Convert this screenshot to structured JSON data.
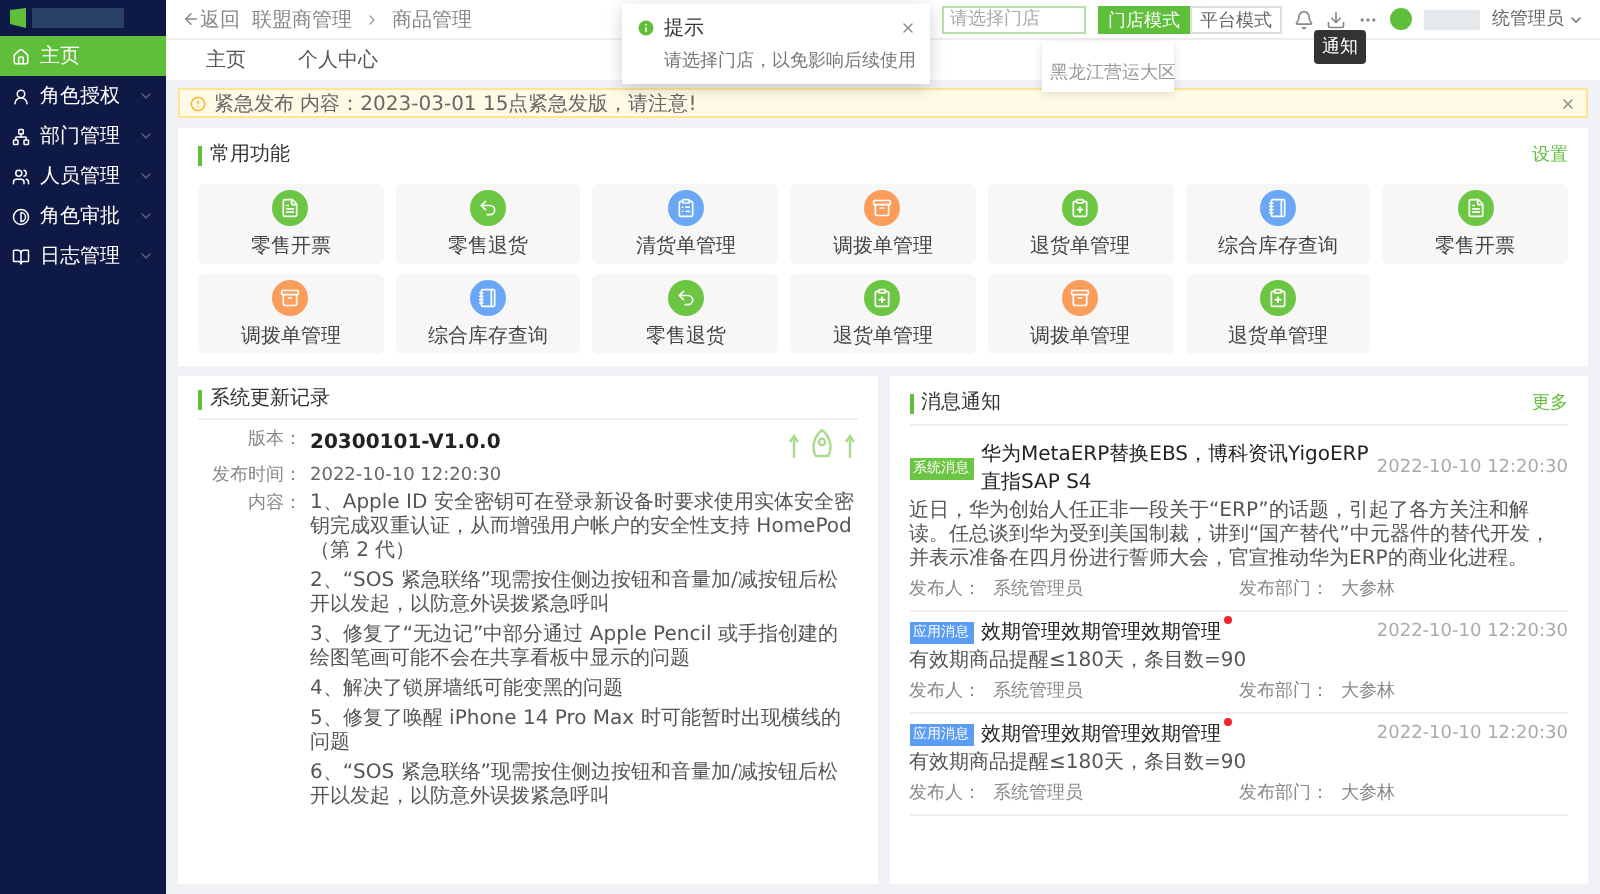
{
  "sidebar": {
    "items": [
      {
        "label": "主页",
        "kind": "home",
        "selected": true,
        "expandable": false
      },
      {
        "label": "角色授权",
        "kind": "user",
        "selected": false,
        "expandable": true
      },
      {
        "label": "部门管理",
        "kind": "org",
        "selected": false,
        "expandable": true
      },
      {
        "label": "人员管理",
        "kind": "people",
        "selected": false,
        "expandable": true
      },
      {
        "label": "角色审批",
        "kind": "approve",
        "selected": false,
        "expandable": true
      },
      {
        "label": "日志管理",
        "kind": "log",
        "selected": false,
        "expandable": true
      }
    ]
  },
  "header": {
    "back": "返回",
    "breadcrumbs": [
      "联盟商管理",
      "商品管理"
    ],
    "store_select": {
      "placeholder": "请选择门店",
      "options": [
        "黑龙江营运大区"
      ]
    },
    "modes": [
      {
        "label": "门店模式",
        "selected": true
      },
      {
        "label": "平台模式",
        "selected": false
      }
    ],
    "tooltip": "通知",
    "user": "统管理员"
  },
  "toast": {
    "title": "提示",
    "message": "请选择门店，以免影响后续使用"
  },
  "tabs": [
    {
      "label": "主页"
    },
    {
      "label": "个人中心"
    }
  ],
  "alert": {
    "text": "紧急发布 内容：2023-03-01 15点紧急发版，请注意!"
  },
  "shortcuts": {
    "title": "常用功能",
    "action": "设置",
    "items": [
      {
        "label": "零售开票",
        "kind": "document",
        "color": "#6cc644"
      },
      {
        "label": "零售退货",
        "kind": "return",
        "color": "#6cc644"
      },
      {
        "label": "清货单管理",
        "kind": "clipboard",
        "color": "#6aa8f7"
      },
      {
        "label": "调拨单管理",
        "kind": "archive",
        "color": "#fb9d5a"
      },
      {
        "label": "退货单管理",
        "kind": "entry",
        "color": "#6cc644"
      },
      {
        "label": "综合库存查询",
        "kind": "notebook",
        "color": "#6aa8f7"
      },
      {
        "label": "零售开票",
        "kind": "document",
        "color": "#6cc644"
      },
      {
        "label": "调拨单管理",
        "kind": "archive",
        "color": "#fb9d5a"
      },
      {
        "label": "综合库存查询",
        "kind": "notebook",
        "color": "#6aa8f7"
      },
      {
        "label": "零售退货",
        "kind": "return",
        "color": "#6cc644"
      },
      {
        "label": "退货单管理",
        "kind": "entry",
        "color": "#6cc644"
      },
      {
        "label": "调拨单管理",
        "kind": "archive",
        "color": "#fb9d5a"
      },
      {
        "label": "退货单管理",
        "kind": "entry",
        "color": "#6cc644"
      }
    ]
  },
  "updates": {
    "title": "系统更新记录",
    "version_label": "版本：",
    "version": "20300101-V1.0.0",
    "time_label": "发布时间：",
    "time": "2022-10-10 12:20:30",
    "content_label": "内容：",
    "items": [
      "1、Apple ID 安全密钥可在登录新设备时要求使用实体安全密钥完成双重认证，从而增强用户帐户的安全性支持 HomePod（第 2 代）",
      "2、“SOS 紧急联络”现需按住侧边按钮和音量加/减按钮后松开以发起，以防意外误拨紧急呼叫",
      "3、修复了“无边记”中部分通过 Apple Pencil 或手指创建的绘图笔画可能不会在共享看板中显示的问题",
      "4、解决了锁屏墙纸可能变黑的问题",
      "5、修复了唤醒 iPhone 14 Pro Max 时可能暂时出现横线的问题",
      "6、“SOS 紧急联络”现需按住侧边按钮和音量加/减按钮后松开以发起，以防意外误拨紧急呼叫"
    ]
  },
  "messages": {
    "title": "消息通知",
    "action": "更多",
    "items": [
      {
        "tag": "系统消息",
        "color": "#6cc644",
        "title": "华为MetaERP替换EBS，博科资讯YigoERP直指SAP S4",
        "unread": false,
        "time": "2022-10-10 12:20:30",
        "body": "近日，华为创始人任正非一段关于“ERP”的话题，引起了各方关注和解读。任总谈到华为受到美国制裁，讲到“国产替代”中元器件的替代开发，并表示准备在四月份进行誓师大会，官宣推动华为ERP的商业化进程。",
        "publisher_label": "发布人：",
        "publisher": "系统管理员",
        "dept_label": "发布部门：",
        "dept": "大参林"
      },
      {
        "tag": "应用消息",
        "color": "#5b9cf5",
        "title": "效期管理效期管理效期管理",
        "unread": true,
        "time": "2022-10-10 12:20:30",
        "body": "有效期商品提醒≤180天，条目数=90",
        "publisher_label": "发布人：",
        "publisher": "系统管理员",
        "dept_label": "发布部门：",
        "dept": "大参林"
      },
      {
        "tag": "应用消息",
        "color": "#5b9cf5",
        "title": "效期管理效期管理效期管理",
        "unread": true,
        "time": "2022-10-10 12:20:30",
        "body": "有效期商品提醒≤180天，条目数=90",
        "publisher_label": "发布人：",
        "publisher": "系统管理员",
        "dept_label": "发布部门：",
        "dept": "大参林"
      }
    ]
  }
}
